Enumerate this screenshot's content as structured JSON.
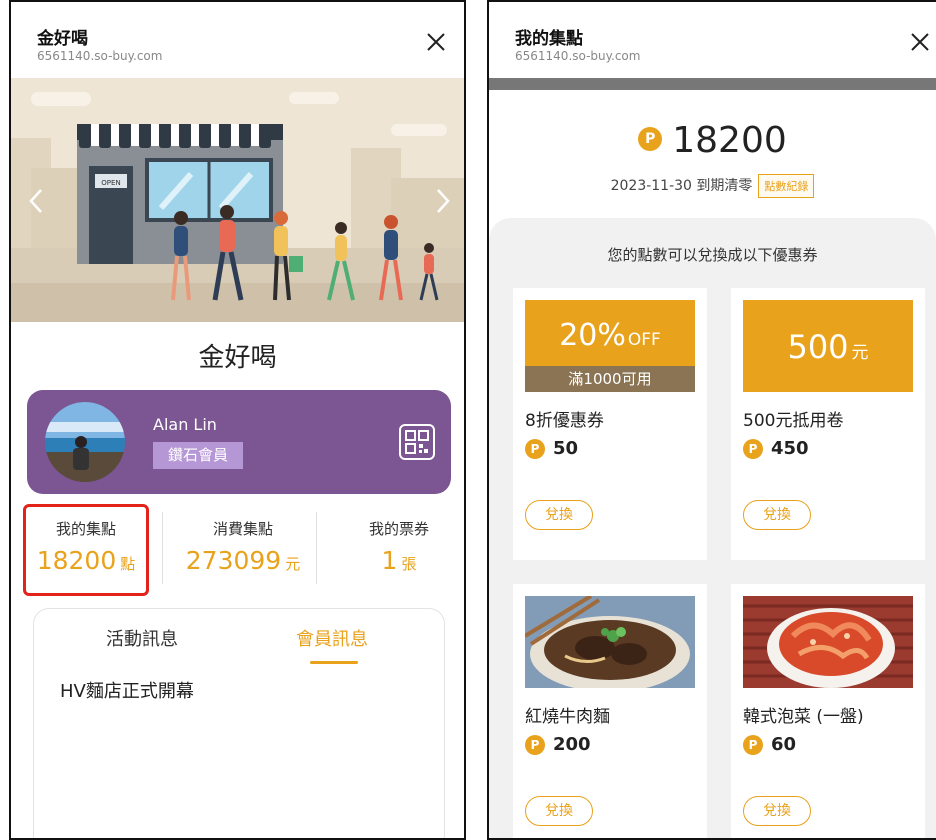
{
  "left": {
    "header": {
      "title": "金好喝",
      "url": "6561140.so-buy.com"
    },
    "store_name": "金好喝",
    "member": {
      "name": "Alan Lin",
      "level": "鑽石會員"
    },
    "stats": [
      {
        "label": "我的集點",
        "value": "18200",
        "unit": "點"
      },
      {
        "label": "消費集點",
        "value": "273099",
        "unit": "元"
      },
      {
        "label": "我的票券",
        "value": "1",
        "unit": "張"
      }
    ],
    "banner": {
      "door_sign": "OPEN"
    },
    "tabs": [
      "活動訊息",
      "會員訊息"
    ],
    "news": [
      "HV麵店正式開幕"
    ]
  },
  "right": {
    "header": {
      "title": "我的集點",
      "url": "6561140.so-buy.com"
    },
    "points": "18200",
    "coin_symbol": "P",
    "expire": "2023-11-30 到期清零",
    "record_label": "點數紀錄",
    "caption": "您的點數可以兌換成以下優惠券",
    "coupons": [
      {
        "name": "8折優惠券",
        "cost": "50",
        "off_value": "20%",
        "off_suffix": "OFF",
        "condition": "滿1000可用",
        "button": "兌換"
      },
      {
        "name": "500元抵用卷",
        "cost": "450",
        "cash_value": "500",
        "cash_unit": "元",
        "button": "兌換"
      },
      {
        "name": "紅燒牛肉麵",
        "cost": "200",
        "button": "兌換"
      },
      {
        "name": "韓式泡菜 (一盤)",
        "cost": "60",
        "button": "兌換"
      }
    ]
  },
  "colors": {
    "accent": "#e9a21b",
    "member_card": "#7b5692",
    "highlight": "#e2231a"
  }
}
